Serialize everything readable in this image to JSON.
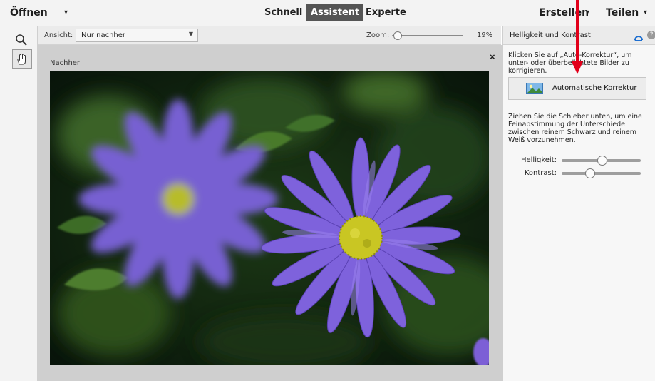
{
  "menubar": {
    "open_label": "Öffnen",
    "open_arrow": "▾",
    "modes": [
      "Schnell",
      "Assistent",
      "Experte"
    ],
    "active_mode": "Assistent",
    "create_label": "Erstellen",
    "create_arrow": "▾",
    "share_label": "Teilen",
    "share_arrow": "▾"
  },
  "toolbar": {
    "tools": [
      "zoom-tool",
      "hand-tool"
    ],
    "selected_tool": "hand-tool"
  },
  "options": {
    "view_label": "Ansicht:",
    "view_value": "Nur nachher",
    "zoom_label": "Zoom:",
    "zoom_percent": 19,
    "zoom_value": "19%"
  },
  "canvas": {
    "title": "Nachher",
    "close_symbol": "×"
  },
  "panel": {
    "title": "Helligkeit und Kontrast",
    "help_symbol": "?",
    "instruction_1": "Klicken Sie auf „Auto-Korrektur“, um unter- oder überbelichtete Bilder zu korrigieren.",
    "auto_button_label": "Automatische Korrektur",
    "instruction_2": "Ziehen Sie die Schieber unten, um eine Feinabstimmung der Unterschiede zwischen reinem Schwarz und reinem Weiß vorzunehmen.",
    "brightness_label": "Helligkeit:",
    "brightness_level": 0.5,
    "contrast_label": "Kontrast:",
    "contrast_level": 0.35
  },
  "colors": {
    "accent_red": "#e2001a",
    "flower_purple": "#7b5fd6",
    "flower_center": "#c9c623",
    "foliage_dark": "#0f1f0c"
  }
}
